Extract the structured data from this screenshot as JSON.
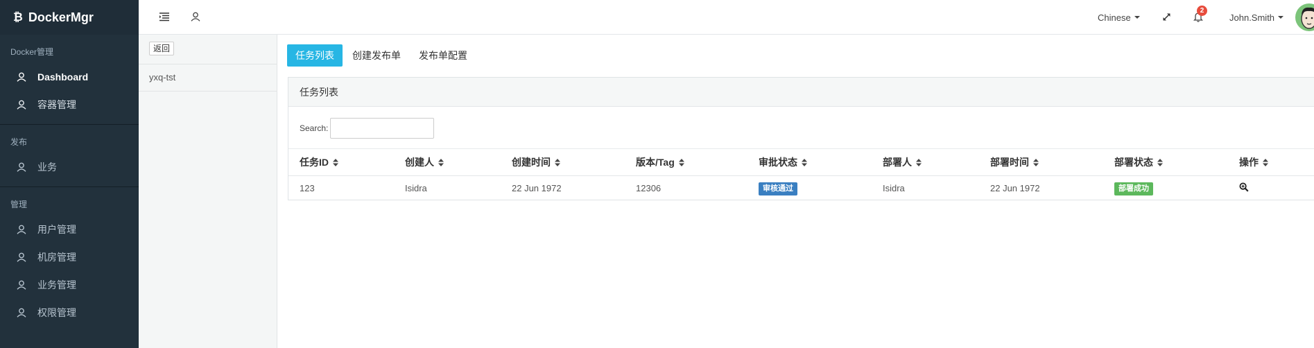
{
  "brand": {
    "name": "DockerMgr",
    "logo_icon": "bitcoin-b-icon"
  },
  "sidebar": {
    "sections": [
      {
        "title": "Docker管理",
        "items": [
          {
            "label": "Dashboard"
          },
          {
            "label": "容器管理"
          }
        ]
      },
      {
        "title": "发布",
        "items": [
          {
            "label": "业务"
          }
        ]
      },
      {
        "title": "管理",
        "items": [
          {
            "label": "用户管理"
          },
          {
            "label": "机房管理"
          },
          {
            "label": "业务管理"
          },
          {
            "label": "权限管理"
          }
        ]
      }
    ]
  },
  "topbar": {
    "language": "Chinese",
    "notification_count": "2",
    "username": "John.Smith"
  },
  "subpanel": {
    "back_label": "返回",
    "items": [
      {
        "label": "yxq-tst"
      }
    ]
  },
  "tabs": [
    {
      "label": "任务列表",
      "active": true
    },
    {
      "label": "创建发布单",
      "active": false
    },
    {
      "label": "发布单配置",
      "active": false
    }
  ],
  "card": {
    "title": "任务列表",
    "search_label": "Search:",
    "search_value": ""
  },
  "table": {
    "columns": [
      "任务ID",
      "创建人",
      "创建时间",
      "版本/Tag",
      "审批状态",
      "部署人",
      "部署时间",
      "部署状态",
      "操作"
    ],
    "rows": [
      {
        "id": "123",
        "creator": "Isidra",
        "created_at": "22 Jun 1972",
        "version": "12306",
        "approval": "审核通过",
        "deployer": "Isidra",
        "deployed_at": "22 Jun 1972",
        "deploy_status": "部署成功",
        "action_icon": "zoom-in-icon"
      }
    ]
  },
  "colors": {
    "sidebar_bg": "#22313c",
    "tab_active": "#27b6e4",
    "approval_badge": "#3a7fc1",
    "deploy_badge": "#5cb85c",
    "notification_badge": "#e74c3c"
  }
}
